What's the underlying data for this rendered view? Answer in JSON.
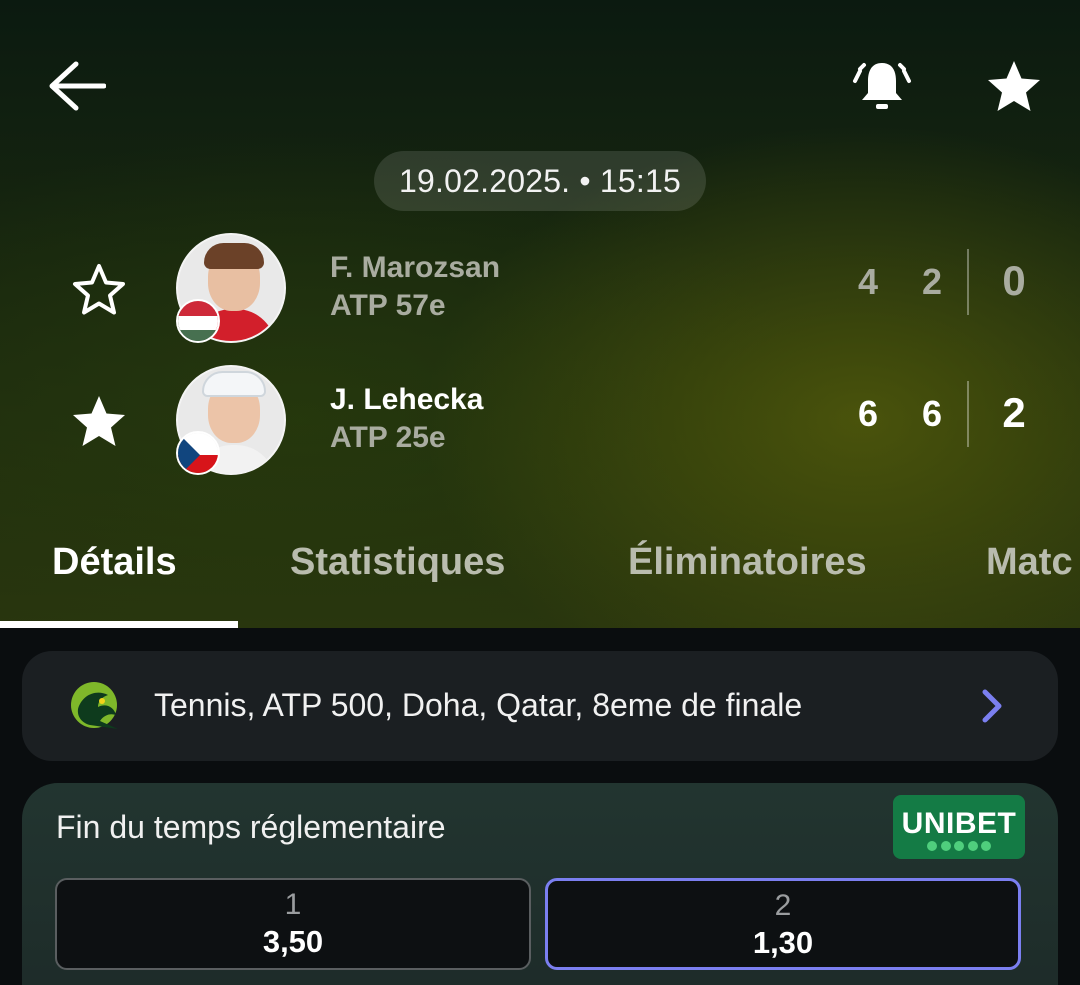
{
  "header": {
    "icons": {
      "back": "arrow-left-icon",
      "alert": "bell-ringing-icon",
      "favorite": "star-filled-icon"
    },
    "datetime": "19.02.2025. • 15:15"
  },
  "players": [
    {
      "name": "F. Marozsan",
      "rank": "ATP 57e",
      "sets": [
        "4",
        "2"
      ],
      "total": "0",
      "favorited": false,
      "flag": "hungary-flag",
      "winner": false
    },
    {
      "name": "J. Lehecka",
      "rank": "ATP 25e",
      "sets": [
        "6",
        "6"
      ],
      "total": "2",
      "favorited": true,
      "flag": "czech-flag",
      "winner": true
    }
  ],
  "tabs": [
    {
      "label": "Détails",
      "active": true
    },
    {
      "label": "Statistiques",
      "active": false
    },
    {
      "label": "Éliminatoires",
      "active": false
    },
    {
      "label": "Matc",
      "active": false
    }
  ],
  "competition": {
    "text": "Tennis, ATP 500, Doha, Qatar, 8eme de finale",
    "icon": "falcon-logo-icon"
  },
  "odds": {
    "title": "Fin du temps réglementaire",
    "bookmaker": "UNIBET",
    "options": [
      {
        "label": "1",
        "value": "3,50",
        "selected": false
      },
      {
        "label": "2",
        "value": "1,30",
        "selected": true
      }
    ]
  },
  "colors": {
    "accent": "#7b7ff0",
    "unibet_green": "#147b45",
    "muted_text": "#a9aca0"
  }
}
